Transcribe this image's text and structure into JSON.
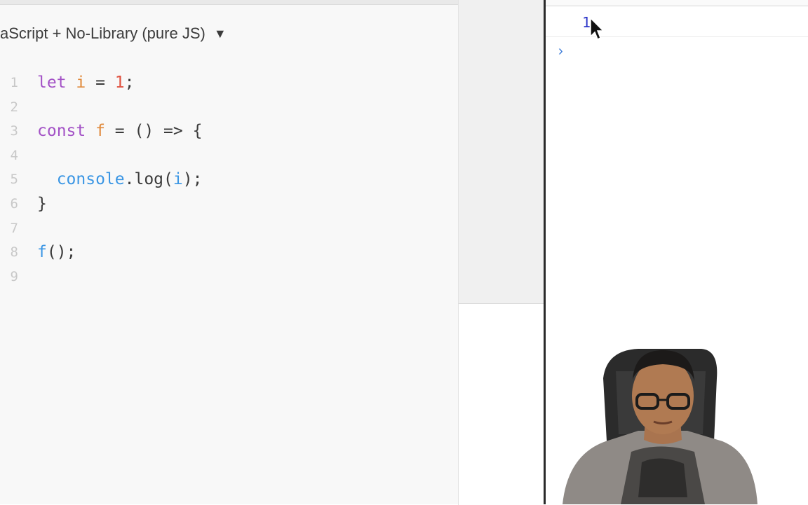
{
  "editor": {
    "language_label": "aScript + No-Library (pure JS)",
    "lines": [
      {
        "num": "1",
        "tokens": [
          {
            "t": "let ",
            "c": "kw"
          },
          {
            "t": "i",
            "c": "var"
          },
          {
            "t": " = ",
            "c": "punc"
          },
          {
            "t": "1",
            "c": "num"
          },
          {
            "t": ";",
            "c": "punc"
          }
        ]
      },
      {
        "num": "2",
        "tokens": []
      },
      {
        "num": "3",
        "tokens": [
          {
            "t": "const ",
            "c": "kw"
          },
          {
            "t": "f",
            "c": "var"
          },
          {
            "t": " = () => {",
            "c": "punc"
          }
        ]
      },
      {
        "num": "4",
        "tokens": []
      },
      {
        "num": "5",
        "tokens": [
          {
            "t": "  console",
            "c": "fn"
          },
          {
            "t": ".log(",
            "c": "punc"
          },
          {
            "t": "i",
            "c": "fn"
          },
          {
            "t": ");",
            "c": "punc"
          }
        ]
      },
      {
        "num": "6",
        "tokens": [
          {
            "t": "}",
            "c": "punc"
          }
        ]
      },
      {
        "num": "7",
        "tokens": []
      },
      {
        "num": "8",
        "tokens": [
          {
            "t": "f",
            "c": "fn"
          },
          {
            "t": "();",
            "c": "punc"
          }
        ]
      },
      {
        "num": "9",
        "tokens": []
      }
    ]
  },
  "console": {
    "output_value": "1",
    "prompt_symbol": "›"
  },
  "icons": {
    "language_caret": "caret-down-icon",
    "prompt": "chevron-right-icon",
    "cursor": "mouse-pointer-icon"
  },
  "colors": {
    "keyword": "#a352c6",
    "variable": "#e08a3c",
    "number": "#e0513f",
    "function": "#3b96e4",
    "console_output": "#2d36c9",
    "prompt": "#3b7bd8"
  }
}
